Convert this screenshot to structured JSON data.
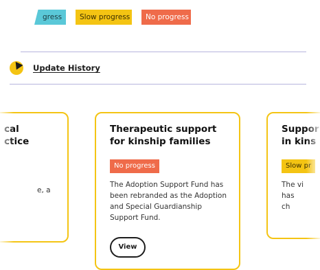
{
  "legend": {
    "partial_label": "gress",
    "slow_label": "Slow progress",
    "no_label": "No progress"
  },
  "history": {
    "link_label": "Update History",
    "icon": "pencil-icon"
  },
  "cards": [
    {
      "title_line1": "cal",
      "title_line2": "ctice",
      "body": "e, a"
    },
    {
      "title_line1": "Therapeutic support",
      "title_line2": "for kinship families",
      "badge": "No progress",
      "body": "The Adoption Support Fund has been rebranded as the Adoption and Special Guardianship Support Fund.",
      "button": "View"
    },
    {
      "title_line1": "Suppor",
      "title_line2": "in kins",
      "badge": "Slow pr",
      "body_line1": "The vi",
      "body_line2": "has",
      "body_line3": "ch"
    }
  ],
  "colors": {
    "partial": "#5ac8d8",
    "slow": "#f4c413",
    "no": "#ef6b4a",
    "rule": "#b6b4de",
    "card_border": "#f4c413"
  }
}
